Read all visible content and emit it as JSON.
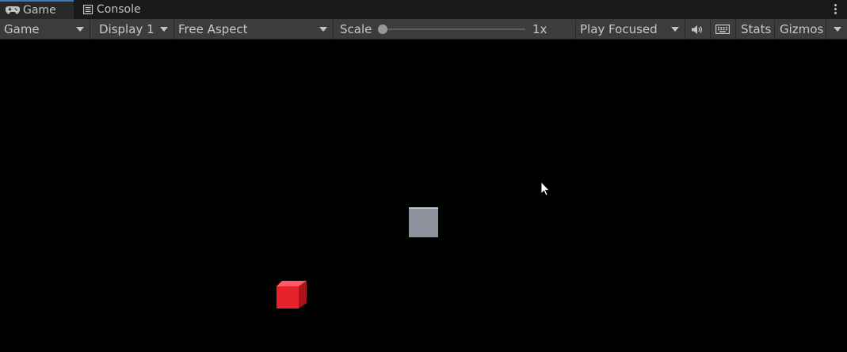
{
  "tabs": [
    {
      "label": "Game",
      "icon": "gamepad-icon",
      "active": true
    },
    {
      "label": "Console",
      "icon": "console-list-icon",
      "active": false
    }
  ],
  "toolbar": {
    "game_dropdown": "Game",
    "display_dropdown": "Display 1",
    "aspect_dropdown": "Free Aspect",
    "scale_label": "Scale",
    "scale_value": "1x",
    "play_mode_dropdown": "Play Focused",
    "audio_icon": "speaker-icon",
    "keyboard_icon": "keyboard-icon",
    "stats_label": "Stats",
    "gizmos_label": "Gizmos"
  },
  "scene": {
    "objects": [
      {
        "name": "grey-cube",
        "color": "#8c919b"
      },
      {
        "name": "red-cube",
        "color": "#e8222b"
      }
    ],
    "cursor_icon": "mouse-pointer-icon"
  },
  "colors": {
    "tab_active_accent": "#3a79bb",
    "toolbar_bg": "#3c3c3c",
    "viewport_bg": "#000000"
  }
}
